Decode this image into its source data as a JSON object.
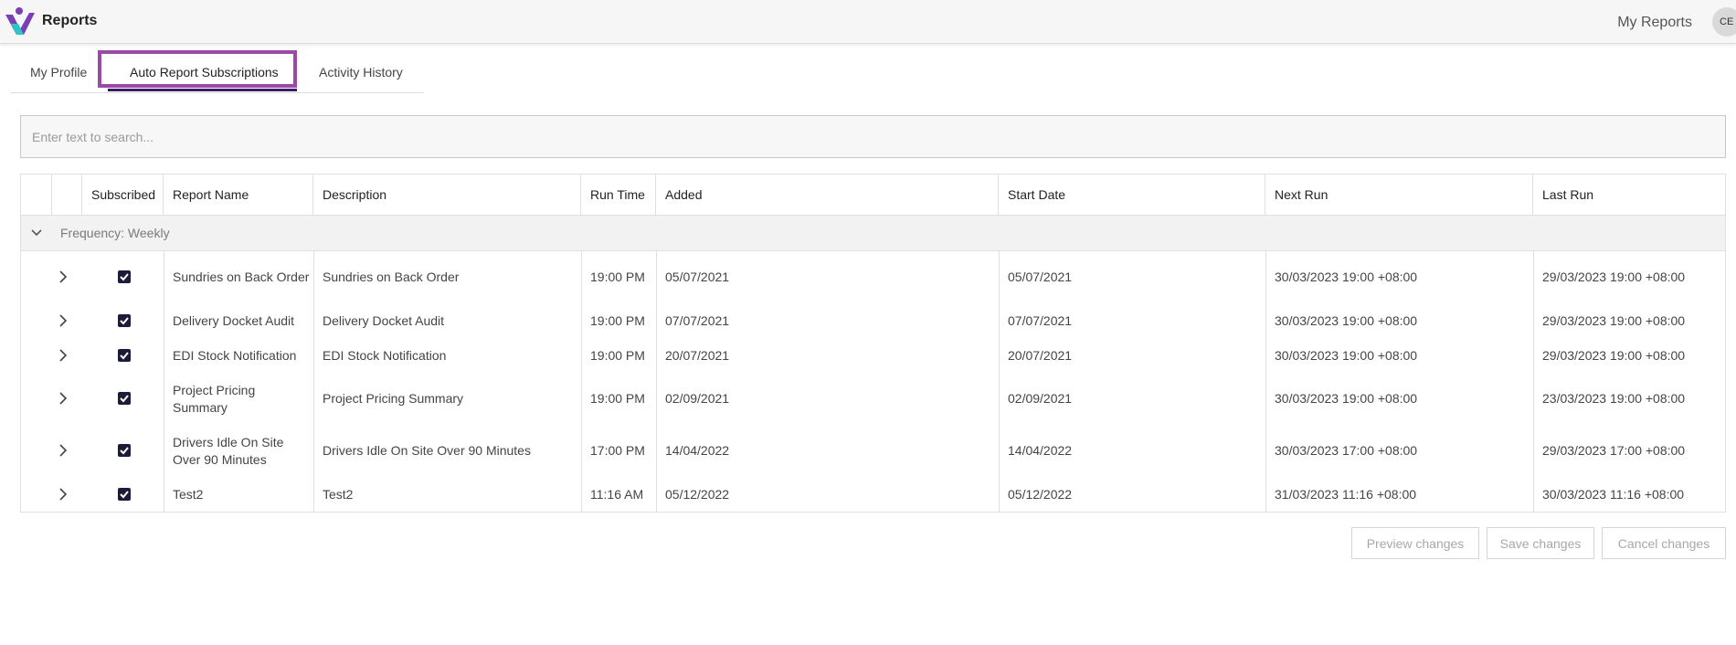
{
  "header": {
    "app_title": "Reports",
    "my_reports_label": "My Reports",
    "avatar_initials": "CE",
    "brand_color": "#7b3fb5",
    "accent_color": "#2ec4c4"
  },
  "tabs": [
    {
      "label": "My Profile",
      "active": false
    },
    {
      "label": "Auto Report Subscriptions",
      "active": true
    },
    {
      "label": "Activity History",
      "active": false
    }
  ],
  "search": {
    "placeholder": "Enter text to search...",
    "value": ""
  },
  "table": {
    "columns": [
      "",
      "",
      "Subscribed",
      "Report Name",
      "Description",
      "Run Time",
      "Added",
      "Start Date",
      "Next Run",
      "Last Run"
    ],
    "group_label": "Frequency: Weekly",
    "rows": [
      {
        "subscribed": true,
        "report_name": "Sundries on Back Order",
        "description": "Sundries on Back Order",
        "run_time": "19:00 PM",
        "added": "05/07/2021",
        "start_date": "05/07/2021",
        "next_run": "30/03/2023 19:00 +08:00",
        "last_run": "29/03/2023 19:00 +08:00"
      },
      {
        "subscribed": true,
        "report_name": "Delivery Docket Audit",
        "description": "Delivery Docket Audit",
        "run_time": "19:00 PM",
        "added": "07/07/2021",
        "start_date": "07/07/2021",
        "next_run": "30/03/2023 19:00 +08:00",
        "last_run": "29/03/2023 19:00 +08:00"
      },
      {
        "subscribed": true,
        "report_name": "EDI Stock Notification",
        "description": "EDI Stock Notification",
        "run_time": "19:00 PM",
        "added": "20/07/2021",
        "start_date": "20/07/2021",
        "next_run": "30/03/2023 19:00 +08:00",
        "last_run": "29/03/2023 19:00 +08:00"
      },
      {
        "subscribed": true,
        "report_name": "Project Pricing Summary",
        "description": "Project Pricing Summary",
        "run_time": "19:00 PM",
        "added": "02/09/2021",
        "start_date": "02/09/2021",
        "next_run": "30/03/2023 19:00 +08:00",
        "last_run": "23/03/2023 19:00 +08:00"
      },
      {
        "subscribed": true,
        "report_name": "Drivers Idle On Site Over 90 Minutes",
        "description": "Drivers Idle On Site Over 90 Minutes",
        "run_time": "17:00 PM",
        "added": "14/04/2022",
        "start_date": "14/04/2022",
        "next_run": "30/03/2023 17:00 +08:00",
        "last_run": "29/03/2023 17:00 +08:00"
      },
      {
        "subscribed": true,
        "report_name": "Test2",
        "description": "Test2",
        "run_time": "11:16 AM",
        "added": "05/12/2022",
        "start_date": "05/12/2022",
        "next_run": "31/03/2023 11:16 +08:00",
        "last_run": "30/03/2023 11:16 +08:00"
      }
    ]
  },
  "actions": {
    "preview_label": "Preview changes",
    "save_label": "Save changes",
    "cancel_label": "Cancel changes"
  }
}
